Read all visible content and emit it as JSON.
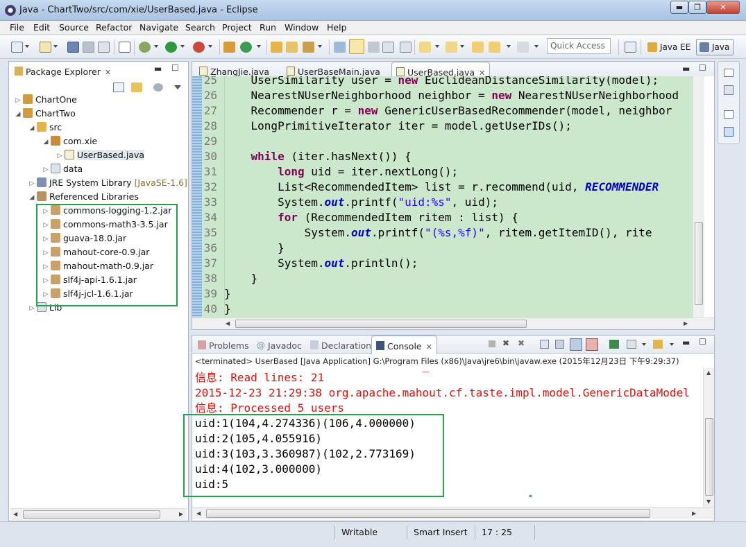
{
  "window": {
    "title": "Java - ChartTwo/src/com/xie/UserBased.java - Eclipse"
  },
  "menu": [
    "File",
    "Edit",
    "Source",
    "Refactor",
    "Navigate",
    "Search",
    "Project",
    "Run",
    "Window",
    "Help"
  ],
  "toolbar": {
    "quick_access_placeholder": "Quick Access",
    "perspectives": [
      {
        "label": "Java EE"
      },
      {
        "label": "Java"
      }
    ]
  },
  "package_explorer": {
    "tab_label": "Package Explorer",
    "tree": [
      {
        "label": "ChartOne"
      },
      {
        "label": "ChartTwo"
      },
      {
        "label": "src"
      },
      {
        "label": "com.xie"
      },
      {
        "label": "UserBased.java"
      },
      {
        "label": "data"
      },
      {
        "label": "JRE System Library",
        "decoration": "[JavaSE-1.6]"
      },
      {
        "label": "Referenced Libraries"
      },
      {
        "label": "commons-logging-1.2.jar"
      },
      {
        "label": "commons-math3-3.5.jar"
      },
      {
        "label": "guava-18.0.jar"
      },
      {
        "label": "mahout-core-0.9.jar"
      },
      {
        "label": "mahout-math-0.9.jar"
      },
      {
        "label": "slf4j-api-1.6.1.jar"
      },
      {
        "label": "slf4j-jcl-1.6.1.jar"
      },
      {
        "label": "Lib"
      }
    ]
  },
  "editor": {
    "tabs": [
      {
        "label": "ZhangJie.java"
      },
      {
        "label": "UserBaseMain.java"
      },
      {
        "label": "UserBased.java"
      }
    ],
    "lines": [
      {
        "n": "25",
        "code": "UserSimilarity user = new EuclideanDistanceSimilarity(model);"
      },
      {
        "n": "26",
        "code": "NearestNUserNeighborhood neighbor = new NearestNUserNeighborhood"
      },
      {
        "n": "27",
        "code": "Recommender r = new GenericUserBasedRecommender(model, neighbor"
      },
      {
        "n": "28",
        "code": "LongPrimitiveIterator iter = model.getUserIDs();"
      },
      {
        "n": "29",
        "code": ""
      },
      {
        "n": "30",
        "code": "while (iter.hasNext()) {"
      },
      {
        "n": "31",
        "code": "long uid = iter.nextLong();"
      },
      {
        "n": "32",
        "code": "List<RecommendedItem> list = r.recommend(uid, RECOMMENDER"
      },
      {
        "n": "33",
        "code": "System.out.printf(\"uid:%s\", uid);"
      },
      {
        "n": "34",
        "code": "for (RecommendedItem ritem : list) {"
      },
      {
        "n": "35",
        "code": "System.out.printf(\"(%s,%f)\", ritem.getItemID(), rite"
      },
      {
        "n": "36",
        "code": "}"
      },
      {
        "n": "37",
        "code": "System.out.println();"
      },
      {
        "n": "38",
        "code": "}"
      },
      {
        "n": "39",
        "code": "}"
      },
      {
        "n": "40",
        "code": "}"
      }
    ]
  },
  "console_view": {
    "tabs": [
      {
        "label": "Problems"
      },
      {
        "label": "Javadoc"
      },
      {
        "label": "Declaration"
      },
      {
        "label": "Console"
      }
    ],
    "header": "<terminated> UserBased [Java Application] G:\\Program Files (x86)\\Java\\jre6\\bin\\javaw.exe (2015年12月23日 下午9:29:37)",
    "log_lines": [
      "信息: Read lines: 21",
      "2015-12-23 21:29:38 org.apache.mahout.cf.taste.impl.model.GenericDataModel",
      "信息: Processed 5 users"
    ],
    "output_lines": [
      "uid:1(104,4.274336)(106,4.000000)",
      "uid:2(105,4.055916)",
      "uid:3(103,3.360987)(102,2.773169)",
      "uid:4(102,3.000000)",
      "uid:5"
    ]
  },
  "status_bar": {
    "mode": "Writable",
    "insert": "Smart Insert",
    "position": "17 : 25"
  },
  "colors": {
    "highlight_box": "#22a14a",
    "editor_bg": "#cce8cc",
    "log_red": "#e01010"
  }
}
